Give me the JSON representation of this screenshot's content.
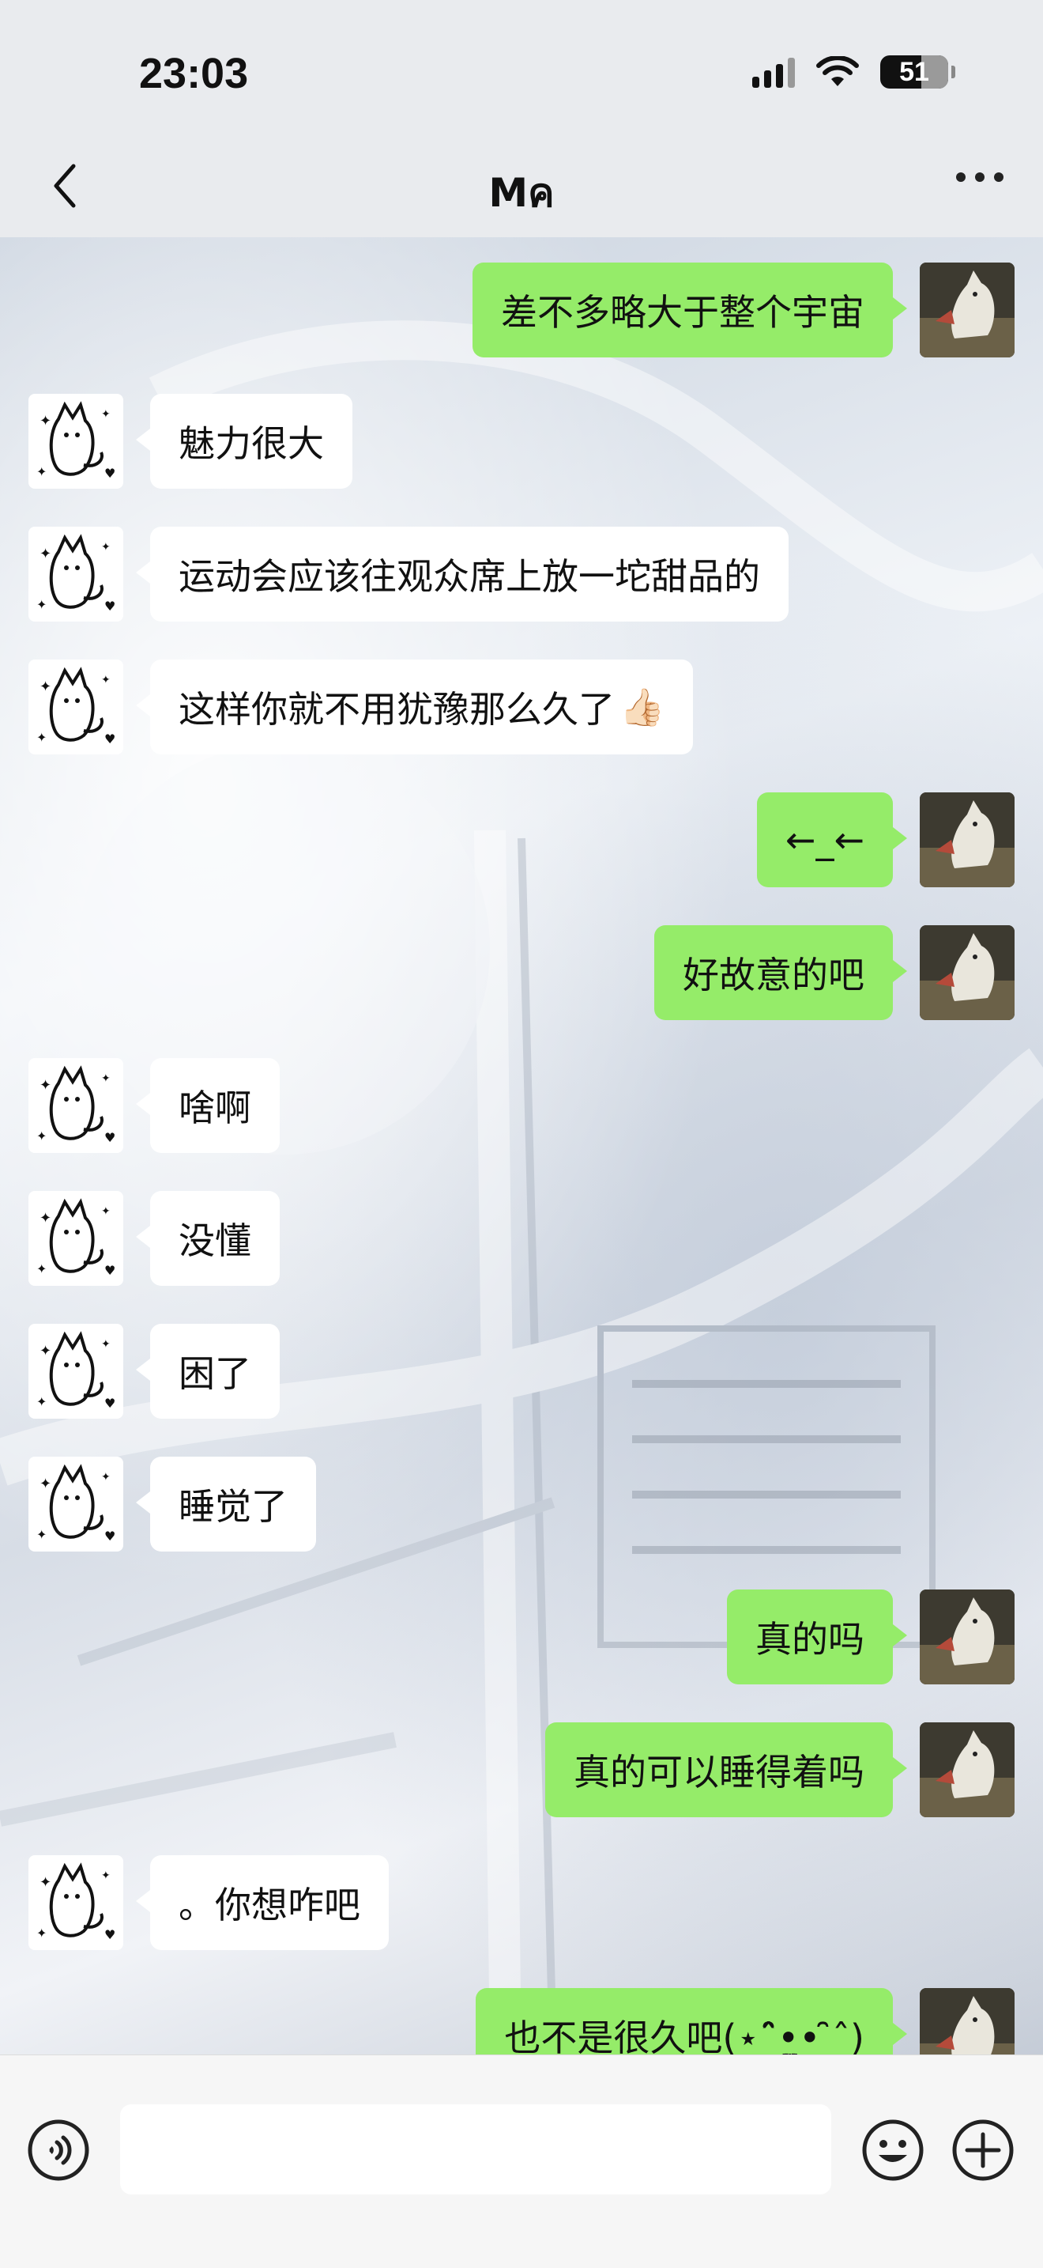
{
  "status": {
    "time": "23:03",
    "battery": "51"
  },
  "nav": {
    "title": "Mค",
    "back_icon": "chevron-left-icon",
    "more_icon": "more-dots-icon"
  },
  "messages": [
    {
      "side": "right",
      "text": "差不多略大于整个宇宙"
    },
    {
      "side": "left",
      "text": "魅力很大"
    },
    {
      "side": "left",
      "text": "运动会应该往观众席上放一坨甜品的"
    },
    {
      "side": "left",
      "text": "这样你就不用犹豫那么久了",
      "emoji": "👍🏻"
    },
    {
      "side": "right",
      "text": "←_←"
    },
    {
      "side": "right",
      "text": "好故意的吧"
    },
    {
      "side": "left",
      "text": "啥啊"
    },
    {
      "side": "left",
      "text": "没懂"
    },
    {
      "side": "left",
      "text": "困了"
    },
    {
      "side": "left",
      "text": "睡觉了"
    },
    {
      "side": "right",
      "text": "真的吗"
    },
    {
      "side": "right",
      "text": "真的可以睡得着吗"
    },
    {
      "side": "left",
      "text": "。你想咋吧"
    },
    {
      "side": "right",
      "text": "也不是很久吧(⋆ˆ̑•̤̫• ̑ˆ)"
    }
  ],
  "input": {
    "value": "",
    "voice_icon": "voice-icon",
    "emoji_icon": "emoji-icon",
    "plus_icon": "plus-icon"
  },
  "colors": {
    "my_bubble": "#95ec69",
    "their_bubble": "#ffffff",
    "nav_bg": "#e9ebee",
    "input_bg": "#f6f6f6"
  }
}
